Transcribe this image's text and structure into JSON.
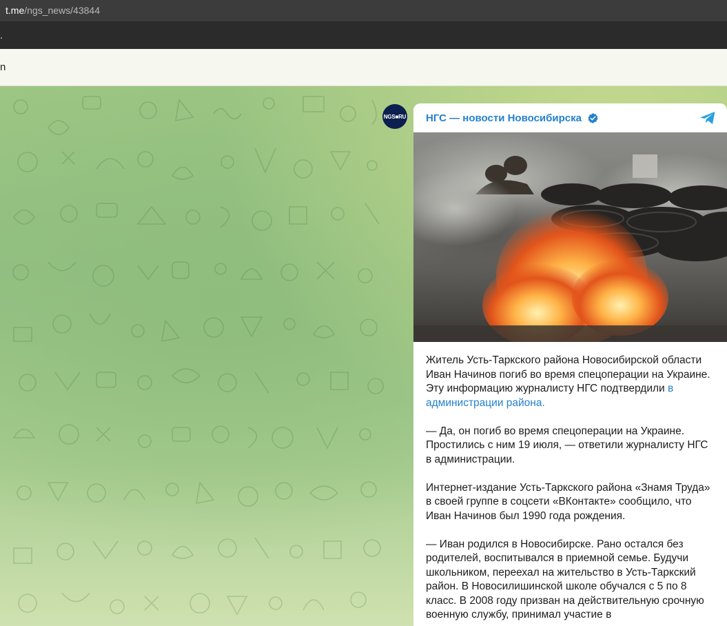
{
  "browser": {
    "url_host": "t.me",
    "url_path": "/ngs_news/43844"
  },
  "infobar": {
    "text": "n"
  },
  "toolbar": {
    "text": "."
  },
  "channel": {
    "name": "НГС — новости Новосибирска",
    "avatar_text": "NGS■RU",
    "verified_icon": "verified-check-icon",
    "share_icon": "telegram-plane-icon",
    "accent_color": "#2481cc"
  },
  "post": {
    "p1_text": "Житель Усть-Таркского района Новосибирской области Иван Начинов погиб во время спецоперации на Украине. Эту информацию журналисту НГС подтвердили ",
    "p1_link": "в администрации района.",
    "p2": "— Да, он погиб во время спецоперации на Украине. Простились с ним 19 июля, — ответили журналисту НГС в администрации.",
    "p3": "Интернет-издание Усть-Таркского района «Знамя Труда» в своей группе в соцсети «ВКонтакте» сообщило, что Иван Начинов был 1990 года рождения.",
    "p4": "— Иван родился в Новосибирске. Рано остался без родителей, воспитывался в приемной семье. Будучи школьником, переехал на жительство в Усть-Таркский район. В Новосилишинской школе обучался с 5 по 8 класс. В 2008 году призван на действительную срочную военную службу, принимал участие в"
  }
}
